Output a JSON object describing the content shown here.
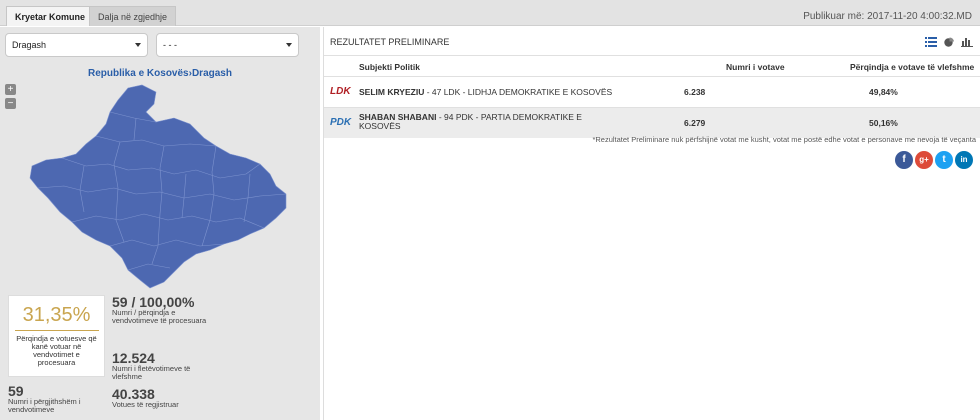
{
  "tabs": [
    "Kryetar Komune",
    "Dalja në zgjedhje"
  ],
  "published": "Publikuar më: 2017-11-20 4:00:32.MD",
  "selects": {
    "municipality": "Dragash",
    "second": "- - -"
  },
  "map": {
    "title_prefix": "Republika e Kosovës",
    "separator": "›",
    "title_current": "Dragash",
    "fill_color": "#4d68b1"
  },
  "zoom": {
    "plus": "+",
    "minus": "−"
  },
  "turnout": {
    "value": "31,35%",
    "label": "Përqindja e votuesve që kanë votuar në vendvotimet e procesuara"
  },
  "stats": {
    "processed": {
      "value": "59 / 100,00%",
      "label": "Numri / përqindja e vendvotimeve të procesuara"
    },
    "valid": {
      "value": "12.524",
      "label": "Numri i fletëvotimeve të vlefshme"
    },
    "total_stations": {
      "value": "59",
      "label": "Numri i përgjithshëm i vendvotimeve"
    },
    "registered": {
      "value": "40.338",
      "label": "Votues të regjistruar"
    }
  },
  "results": {
    "title": "REZULTATET PRELIMINARE",
    "headers": {
      "subject": "Subjekti Politik",
      "votes": "Numri i votave",
      "pct": "Përqindja e votave të vlefshme"
    },
    "rows": [
      {
        "logo": "LDK",
        "logo_color": "#b01f24",
        "candidate": "SELIM KRYEZIU",
        "party": " - 47 LDK - LIDHJA DEMOKRATIKE E KOSOVËS",
        "votes": "6.238",
        "pct": "49,84%"
      },
      {
        "logo": "PDK",
        "logo_color": "#2a6fb3",
        "candidate": "SHABAN SHABANI",
        "party": " - 94 PDK - PARTIA DEMOKRATIKE E KOSOVËS",
        "votes": "6.279",
        "pct": "50,16%"
      }
    ],
    "note": "*Rezultatet Preliminare nuk përfshijnë votat me kusht, votat me postë edhe votat e personave me nevoja të veçanta"
  },
  "view_icons": [
    "list-view-icon",
    "pie-chart-icon",
    "bar-chart-icon"
  ],
  "social": [
    {
      "name": "facebook",
      "glyph": "f",
      "color": "#3b5998"
    },
    {
      "name": "google-plus",
      "glyph": "g+",
      "color": "#dd4b39"
    },
    {
      "name": "twitter",
      "glyph": "t",
      "color": "#1da1f2"
    },
    {
      "name": "linkedin",
      "glyph": "in",
      "color": "#0077b5"
    }
  ]
}
